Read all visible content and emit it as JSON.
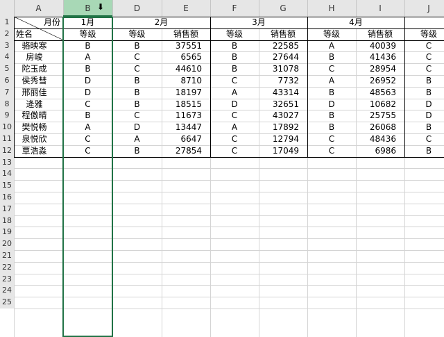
{
  "sheet": {
    "column_letters": [
      "A",
      "B",
      "D",
      "E",
      "F",
      "G",
      "H",
      "I",
      "J"
    ],
    "row_numbers": [
      "1",
      "2",
      "3",
      "4",
      "5",
      "6",
      "7",
      "8",
      "9",
      "10",
      "11",
      "12",
      "13",
      "14",
      "15",
      "16",
      "17",
      "18",
      "19",
      "20",
      "21",
      "22",
      "23",
      "24",
      "25"
    ],
    "selected_column": "B",
    "header_row1": {
      "corner_label": "月份",
      "months": [
        "1月",
        "2月",
        "3月",
        "4月"
      ]
    },
    "header_row2": [
      "姓名",
      "等级",
      "等级",
      "销售额",
      "等级",
      "销售额",
      "等级",
      "销售额",
      "等级"
    ],
    "rows": [
      [
        "骆映寒",
        "B",
        "B",
        "37551",
        "B",
        "22585",
        "A",
        "40039",
        "C"
      ],
      [
        "房峻",
        "A",
        "C",
        "6565",
        "B",
        "27644",
        "B",
        "41436",
        "C"
      ],
      [
        "陀玉成",
        "B",
        "C",
        "44610",
        "B",
        "31078",
        "C",
        "28954",
        "C"
      ],
      [
        "侯秀彗",
        "D",
        "B",
        "8710",
        "C",
        "7732",
        "A",
        "26952",
        "B"
      ],
      [
        "邢丽佳",
        "D",
        "B",
        "18197",
        "A",
        "43314",
        "B",
        "48563",
        "B"
      ],
      [
        "逄雅",
        "C",
        "B",
        "18515",
        "D",
        "32651",
        "D",
        "10682",
        "D"
      ],
      [
        "程傲晴",
        "B",
        "C",
        "11673",
        "C",
        "43027",
        "B",
        "25755",
        "D"
      ],
      [
        "樊悦畅",
        "A",
        "D",
        "13447",
        "A",
        "17892",
        "B",
        "26068",
        "B"
      ],
      [
        "泉悦欣",
        "C",
        "A",
        "6647",
        "C",
        "12794",
        "C",
        "48436",
        "C"
      ],
      [
        "覃浩淼",
        "C",
        "B",
        "27854",
        "C",
        "17049",
        "C",
        "6986",
        "B"
      ]
    ],
    "cursor_icon": "down-arrow-select-column-cursor",
    "colors": {
      "header_bg": "#e6e6e6",
      "selected_header_bg": "#a8d8b6",
      "selection_border": "#217346",
      "gridline": "#d4d4d4"
    }
  }
}
